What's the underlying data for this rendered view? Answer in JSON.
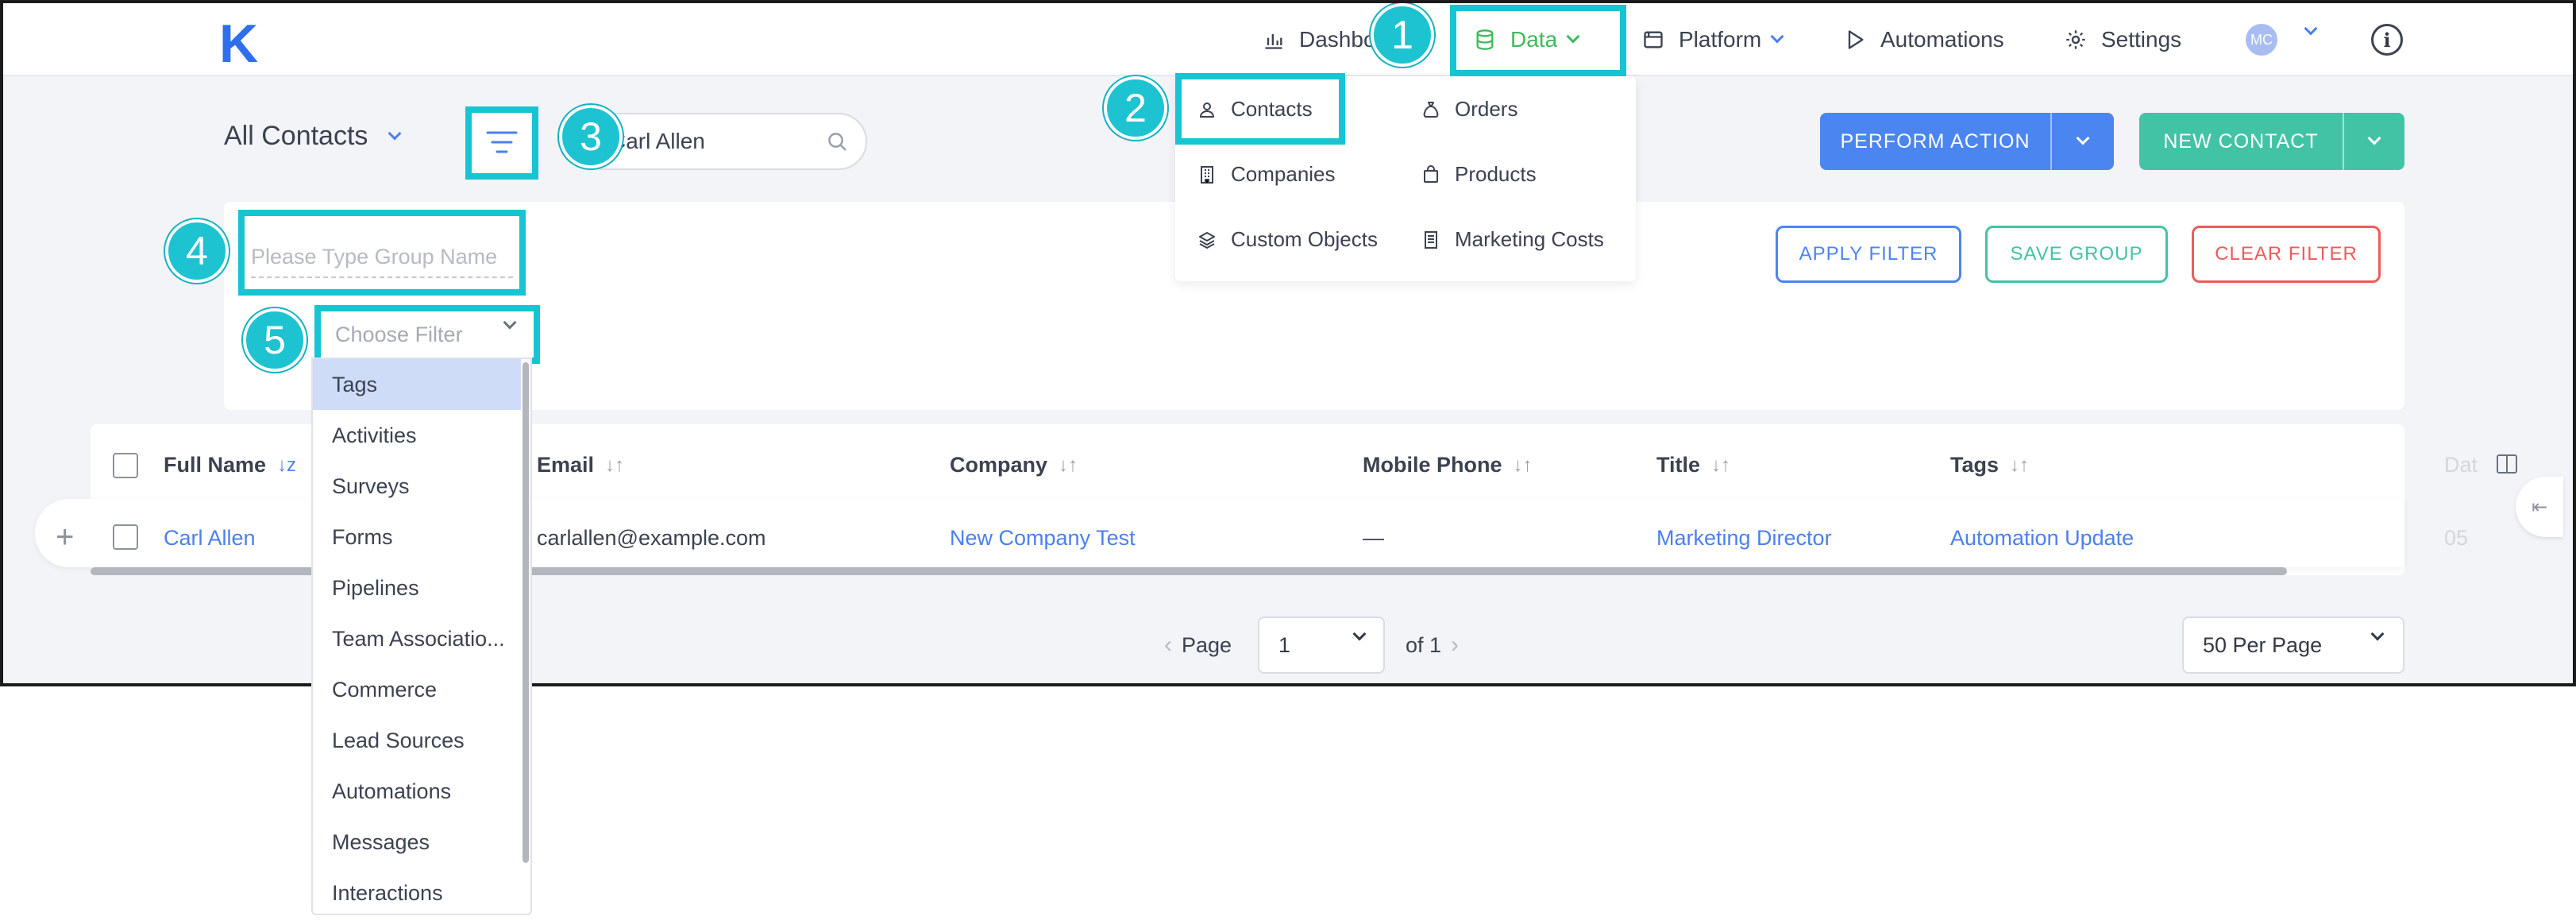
{
  "app": {
    "logo_letter": "K"
  },
  "nav": {
    "dashboard": "Dashboard",
    "data": "Data",
    "platform": "Platform",
    "automations": "Automations",
    "settings": "Settings",
    "avatar_initials": "MC",
    "info": "i"
  },
  "data_menu": {
    "contacts": "Contacts",
    "orders": "Orders",
    "companies": "Companies",
    "products": "Products",
    "custom_objects": "Custom Objects",
    "marketing_costs": "Marketing Costs"
  },
  "header": {
    "view_title": "All Contacts",
    "search_value": "Carl Allen",
    "perform_action": "PERFORM ACTION",
    "new_contact": "NEW CONTACT"
  },
  "filter_panel": {
    "group_name_placeholder": "Please Type Group Name",
    "choose_filter_placeholder": "Choose Filter",
    "apply_filter": "APPLY FILTER",
    "save_group": "SAVE GROUP",
    "clear_filter": "CLEAR FILTER",
    "options": [
      "Tags",
      "Activities",
      "Surveys",
      "Forms",
      "Pipelines",
      "Team Associatio...",
      "Commerce",
      "Lead Sources",
      "Automations",
      "Messages",
      "Interactions"
    ],
    "selected_option": "Tags"
  },
  "table": {
    "columns": {
      "full_name": "Full Name",
      "email": "Email",
      "company": "Company",
      "mobile_phone": "Mobile Phone",
      "title": "Title",
      "tags": "Tags",
      "date": "Dat"
    },
    "row": {
      "full_name": "Carl Allen",
      "email": "carlallen@example.com",
      "company": "New Company Test",
      "mobile_phone": "—",
      "title": "Marketing Director",
      "tags": "Automation Update",
      "date": "05"
    }
  },
  "pagination": {
    "page_label": "Page",
    "current_page": "1",
    "of_label": "of 1",
    "per_page": "50 Per Page"
  },
  "callouts": [
    "1",
    "2",
    "3",
    "4",
    "5"
  ],
  "colors": {
    "accent": "#1ec3d1",
    "primary": "#4b85f0",
    "success": "#43c3a6",
    "danger": "#ef5a5a",
    "nav_active": "#3fb95c"
  }
}
